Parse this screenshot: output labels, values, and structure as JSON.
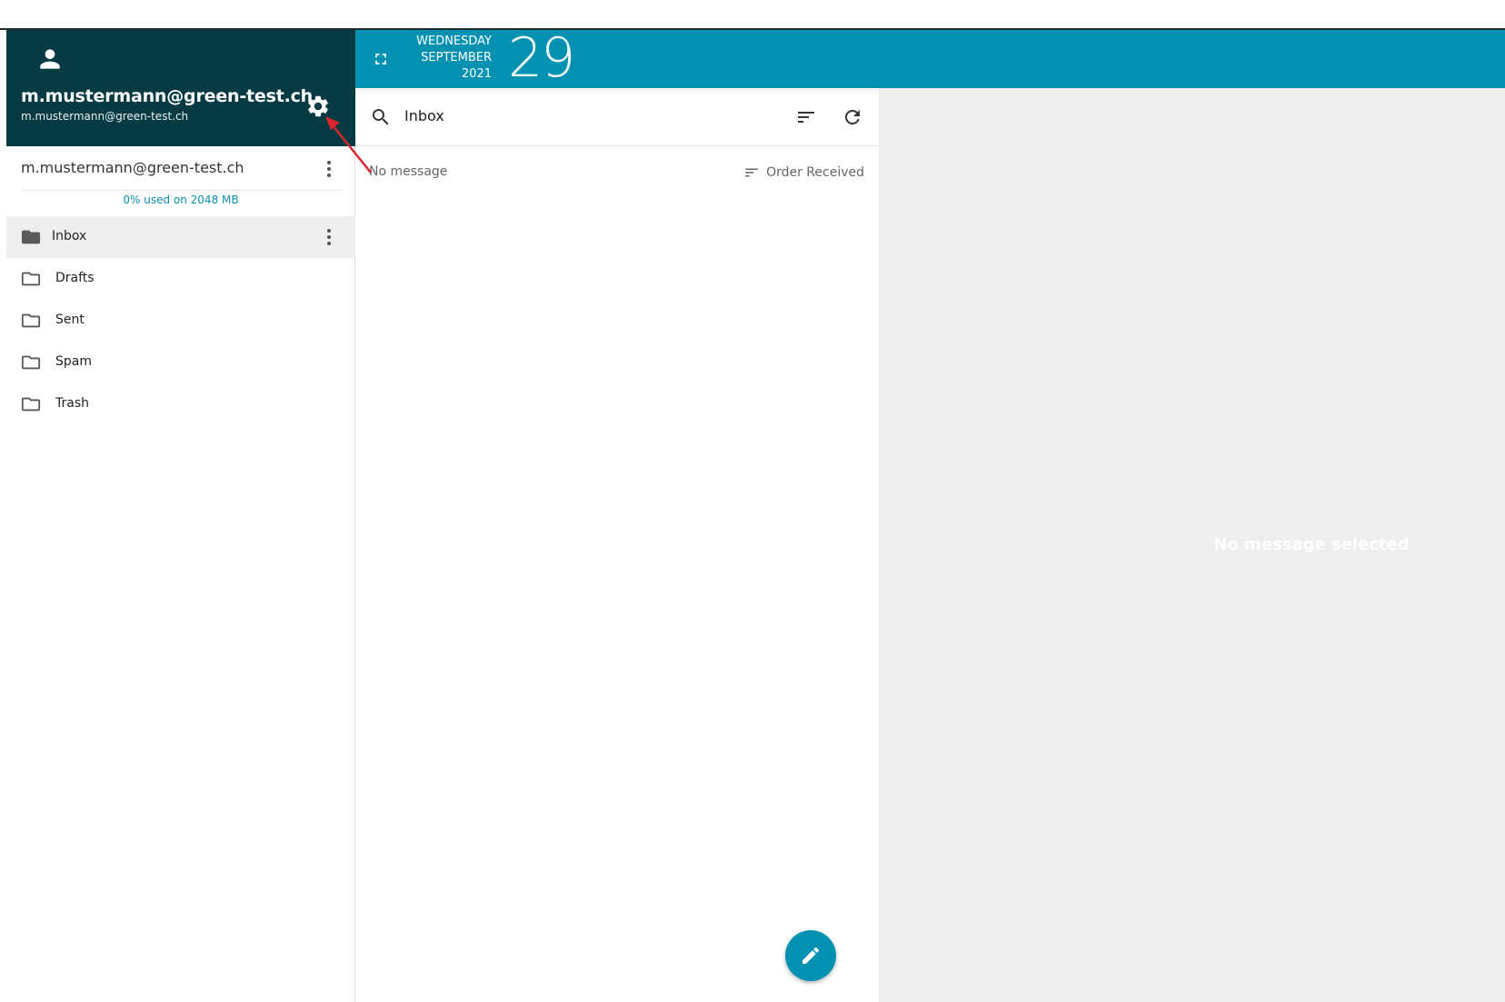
{
  "account": {
    "display_name": "m.mustermann@green-test.ch",
    "email": "m.mustermann@green-test.ch",
    "row_email": "m.mustermann@green-test.ch",
    "quota": "0% used on 2048 MB"
  },
  "folders": [
    {
      "label": "Inbox",
      "active": true
    },
    {
      "label": "Drafts"
    },
    {
      "label": "Sent"
    },
    {
      "label": "Spam"
    },
    {
      "label": "Trash"
    }
  ],
  "topbar": {
    "weekday": "WEDNESDAY",
    "month": "SEPTEMBER",
    "year": "2021",
    "day": "29"
  },
  "list": {
    "title": "Inbox",
    "empty_text": "No message",
    "order_label": "Order Received"
  },
  "reading_pane": {
    "empty_text": "No message selected"
  },
  "colors": {
    "header_bg": "#073b44",
    "accent": "#0391b1",
    "annotation": "#d9262c"
  }
}
